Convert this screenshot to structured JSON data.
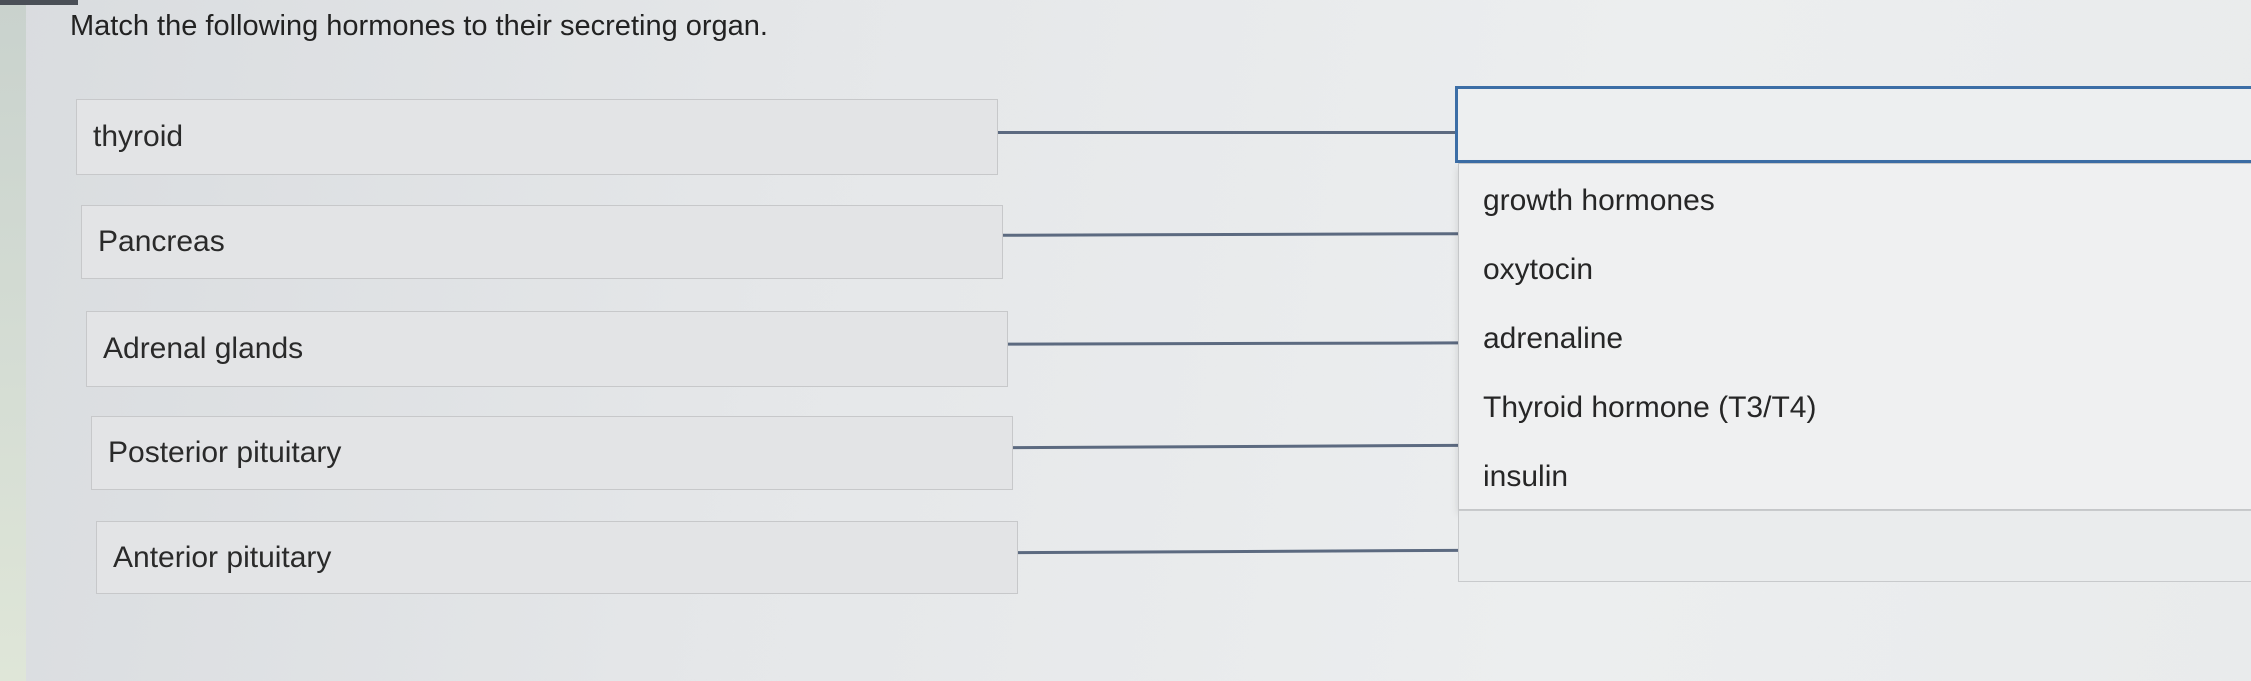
{
  "question": "Match the following hormones to their secreting organ.",
  "prompts": [
    {
      "label": "thyroid"
    },
    {
      "label": "Pancreas"
    },
    {
      "label": "Adrenal glands"
    },
    {
      "label": "Posterior pituitary"
    },
    {
      "label": "Anterior pituitary"
    }
  ],
  "options": [
    {
      "label": "growth hormones"
    },
    {
      "label": "oxytocin"
    },
    {
      "label": "adrenaline"
    },
    {
      "label": "Thyroid hormone (T3/T4)"
    },
    {
      "label": "insulin"
    }
  ],
  "colors": {
    "accent": "#3c6ea6",
    "connector": "#5c6a80"
  }
}
